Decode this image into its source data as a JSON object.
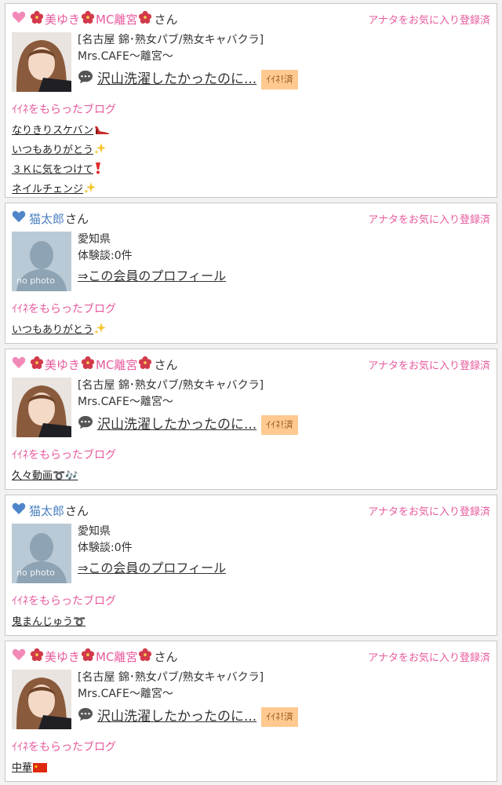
{
  "common": {
    "fav_label": "アナタをお気に入り登録済",
    "got_blog_label": "ｲｲﾈをもらったブログ",
    "san": "さん",
    "iine_done": "ｲｲﾈ!済",
    "profile_link": "⇒この会員のプロフィール"
  },
  "cards": [
    {
      "type": "vip",
      "name": "美ゆき",
      "name2": "MC離宮",
      "shop_line1": "[名古屋 錦･熟女パブ/熟女キャバクラ]",
      "shop_line2": "Mrs.CAFE～離宮～",
      "blog_title": "沢山洗濯したかったのに...",
      "blogs": [
        {
          "text": "なりきりスケバン",
          "emoji": "high-heel"
        },
        {
          "text": "いつもありがとう",
          "emoji": "sparkles"
        },
        {
          "text": "３Ｋに気をつけて",
          "emoji": "exclamation"
        },
        {
          "text": "ネイルチェンジ",
          "emoji": "sparkles"
        }
      ]
    },
    {
      "type": "member",
      "name": "猫太郎",
      "pref": "愛知県",
      "review": "体験談:0件",
      "avatar_text": "no photo",
      "blogs": [
        {
          "text": "いつもありがとう",
          "emoji": "sparkles"
        }
      ]
    },
    {
      "type": "vip",
      "name": "美ゆき",
      "name2": "MC離宮",
      "shop_line1": "[名古屋 錦･熟女パブ/熟女キャバクラ]",
      "shop_line2": "Mrs.CAFE～離宮～",
      "blog_title": "沢山洗濯したかったのに...",
      "blogs": [
        {
          "text": "久々動画➰🎶",
          "emoji": ""
        }
      ]
    },
    {
      "type": "member",
      "name": "猫太郎",
      "pref": "愛知県",
      "review": "体験談:0件",
      "avatar_text": "no photo",
      "blogs": [
        {
          "text": "鬼まんじゅう➰",
          "emoji": ""
        }
      ]
    },
    {
      "type": "vip",
      "name": "美ゆき",
      "name2": "MC離宮",
      "shop_line1": "[名古屋 錦･熟女パブ/熟女キャバクラ]",
      "shop_line2": "Mrs.CAFE～離宮～",
      "blog_title": "沢山洗濯したかったのに...",
      "blogs": [
        {
          "text": "中華",
          "emoji": "china-flag"
        }
      ]
    }
  ]
}
